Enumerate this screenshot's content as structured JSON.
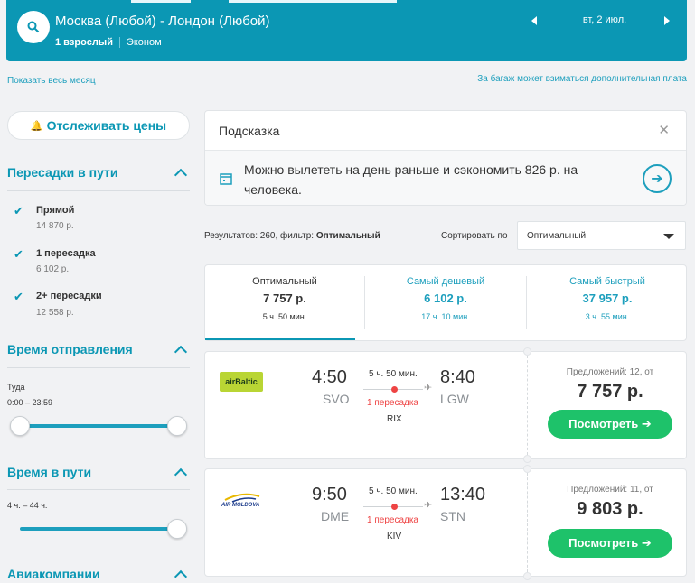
{
  "header": {
    "route": "Москва (Любой) - Лондон (Любой)",
    "passengers": "1 взрослый",
    "cabin_class": "Эконом",
    "date": "вт, 2 июл."
  },
  "links": {
    "show_month": "Показать весь месяц",
    "baggage_notice": "За багаж может взиматься дополнительная плата"
  },
  "sidebar": {
    "track_prices": "Отслеживать цены",
    "stops_title": "Пересадки в пути",
    "stops": [
      {
        "label": "Прямой",
        "price": "14 870 р."
      },
      {
        "label": "1 пересадка",
        "price": "6 102 р."
      },
      {
        "label": "2+ пересадки",
        "price": "12 558 р."
      }
    ],
    "departure_title": "Время отправления",
    "departure_direction": "Туда",
    "departure_range": "0:00 – 23:59",
    "duration_title": "Время в пути",
    "duration_range": "4 ч. – 44 ч.",
    "airlines_title": "Авиакомпании"
  },
  "hint": {
    "title": "Подсказка",
    "text": "Можно вылететь на день раньше и сэкономить 826 р. на человека.",
    "close_symbol": "✕",
    "go_symbol": "➔"
  },
  "results": {
    "count_text": "Результатов: 260, фильтр: ",
    "filter_name": "Оптимальный",
    "sort_label": "Сортировать по",
    "sort_value": "Оптимальный"
  },
  "tabs": [
    {
      "title": "Оптимальный",
      "price": "7 757 р.",
      "duration": "5 ч. 50 мин."
    },
    {
      "title": "Самый дешевый",
      "price": "6 102 р.",
      "duration": "17 ч. 10 мин."
    },
    {
      "title": "Самый быстрый",
      "price": "37 957 р.",
      "duration": "3 ч. 55 мин."
    }
  ],
  "flights": [
    {
      "airline": "airBaltic",
      "dep_time": "4:50",
      "dep_iata": "SVO",
      "arr_time": "8:40",
      "arr_iata": "LGW",
      "duration": "5 ч. 50 мин.",
      "stops": "1 пересадка",
      "via": "RIX",
      "offers": "Предложений: 12, от",
      "price": "7 757 р.",
      "button": "Посмотреть ➔"
    },
    {
      "airline": "AIR MOLDOVA",
      "dep_time": "9:50",
      "dep_iata": "DME",
      "arr_time": "13:40",
      "arr_iata": "STN",
      "duration": "5 ч. 50 мин.",
      "stops": "1 пересадка",
      "via": "KIV",
      "offers": "Предложений: 11, от",
      "price": "9 803 р.",
      "button": "Посмотреть ➔"
    }
  ],
  "colors": {
    "accent": "#0b97b4",
    "link": "#1d9fbd",
    "buy": "#1ec26a",
    "stop": "#e44444"
  }
}
